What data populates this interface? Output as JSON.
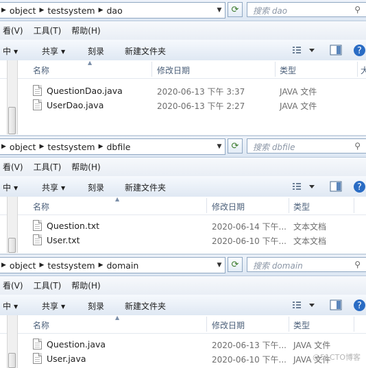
{
  "windows": [
    {
      "path": [
        "object",
        "testsystem",
        "dao"
      ],
      "search_placeholder": "搜索 dao",
      "menu": [
        "看(V)",
        "工具(T)",
        "帮助(H)"
      ],
      "commands": [
        "中",
        "共享",
        "刻录",
        "新建文件夹"
      ],
      "columns": [
        "名称",
        "修改日期",
        "类型",
        "大"
      ],
      "files": [
        {
          "name": "QuestionDao.java",
          "date": "2020-06-13 下午 3:37",
          "type": "JAVA 文件"
        },
        {
          "name": "UserDao.java",
          "date": "2020-06-13 下午 2:27",
          "type": "JAVA 文件"
        }
      ]
    },
    {
      "path": [
        "object",
        "testsystem",
        "dbfile"
      ],
      "search_placeholder": "搜索 dbfile",
      "menu": [
        "看(V)",
        "工具(T)",
        "帮助(H)"
      ],
      "commands": [
        "中",
        "共享",
        "刻录",
        "新建文件夹"
      ],
      "columns": [
        "名称",
        "修改日期",
        "类型"
      ],
      "files": [
        {
          "name": "Question.txt",
          "date": "2020-06-14 下午...",
          "type": "文本文档"
        },
        {
          "name": "User.txt",
          "date": "2020-06-10 下午...",
          "type": "文本文档"
        }
      ]
    },
    {
      "path": [
        "object",
        "testsystem",
        "domain"
      ],
      "search_placeholder": "搜索 domain",
      "menu": [
        "看(V)",
        "工具(T)",
        "帮助(H)"
      ],
      "commands": [
        "中",
        "共享",
        "刻录",
        "新建文件夹"
      ],
      "columns": [
        "名称",
        "修改日期",
        "类型"
      ],
      "files": [
        {
          "name": "Question.java",
          "date": "2020-06-13 下午...",
          "type": "JAVA 文件"
        },
        {
          "name": "User.java",
          "date": "2020-06-10 下午...",
          "type": "JAVA 文件"
        }
      ]
    }
  ],
  "watermark": "@51CTO博客",
  "icons": [
    "chevron-right-icon",
    "dropdown-arrow-icon",
    "refresh-icon",
    "search-icon",
    "views-icon",
    "preview-pane-icon",
    "help-icon",
    "file-icon"
  ]
}
